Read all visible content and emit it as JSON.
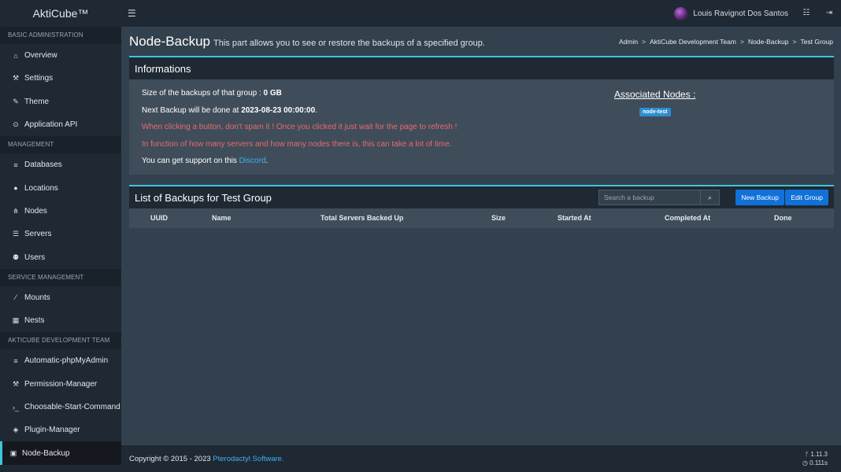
{
  "app": {
    "brand": "AktiCube™"
  },
  "topbar": {
    "user_name": "Louis Ravignot Dos Santos",
    "icons": [
      "hamburger-icon",
      "list-icon",
      "logout-icon"
    ]
  },
  "sidebar": {
    "sections": [
      {
        "header": "BASIC ADMINISTRATION",
        "items": [
          {
            "label": "Overview",
            "icon": "home"
          },
          {
            "label": "Settings",
            "icon": "wrench"
          },
          {
            "label": "Theme",
            "icon": "edit"
          },
          {
            "label": "Application API",
            "icon": "gamepad"
          }
        ]
      },
      {
        "header": "MANAGEMENT",
        "items": [
          {
            "label": "Databases",
            "icon": "database"
          },
          {
            "label": "Locations",
            "icon": "globe"
          },
          {
            "label": "Nodes",
            "icon": "sitemap"
          },
          {
            "label": "Servers",
            "icon": "server"
          },
          {
            "label": "Users",
            "icon": "users"
          }
        ]
      },
      {
        "header": "SERVICE MANAGEMENT",
        "items": [
          {
            "label": "Mounts",
            "icon": "magic"
          },
          {
            "label": "Nests",
            "icon": "th-large"
          }
        ]
      },
      {
        "header": "AKTICUBE DEVELOPMENT TEAM",
        "items": [
          {
            "label": "Automatic-phpMyAdmin",
            "icon": "database"
          },
          {
            "label": "Permission-Manager",
            "icon": "wrench"
          },
          {
            "label": "Choosable-Start-Command",
            "icon": "terminal"
          },
          {
            "label": "Plugin-Manager",
            "icon": "cube"
          },
          {
            "label": "Node-Backup",
            "icon": "save",
            "active": true
          }
        ]
      }
    ]
  },
  "page": {
    "title": "Node-Backup",
    "subtitle": "This part allows you to see or restore the backups of a specified group.",
    "breadcrumb": [
      "Admin",
      "AktiCube Development Team",
      "Node-Backup",
      "Test Group"
    ]
  },
  "info_box": {
    "title": "Informations",
    "size_prefix": "Size of the backups of that group : ",
    "size_value": "0 GB",
    "next_prefix": "Next Backup will be done at ",
    "next_value": "2023-08-23 00:00:00",
    "next_suffix": ".",
    "warning_1": "When clicking a button, don't spam it ! Once you clicked it just wait for the page to refresh !",
    "warning_2": "In function of how many servers and how many nodes there is, this can take a lot of time.",
    "support_prefix": "You can get support on this ",
    "support_link": "Discord",
    "support_suffix": ".",
    "assoc_title": "Associated Nodes :",
    "nodes": [
      "node-test"
    ]
  },
  "backups_box": {
    "title": "List of Backups for Test Group",
    "search_placeholder": "Search a backup",
    "new_backup": "New Backup",
    "edit_group": "Edit Group",
    "columns": [
      "UUID",
      "Name",
      "Total Servers Backed Up",
      "Size",
      "Started At",
      "Completed At",
      "Done"
    ]
  },
  "footer": {
    "copyright": "Copyright © 2015 - 2023 ",
    "link": "Pterodactyl Software.",
    "version": "1.11.3",
    "time": "0.111s"
  }
}
